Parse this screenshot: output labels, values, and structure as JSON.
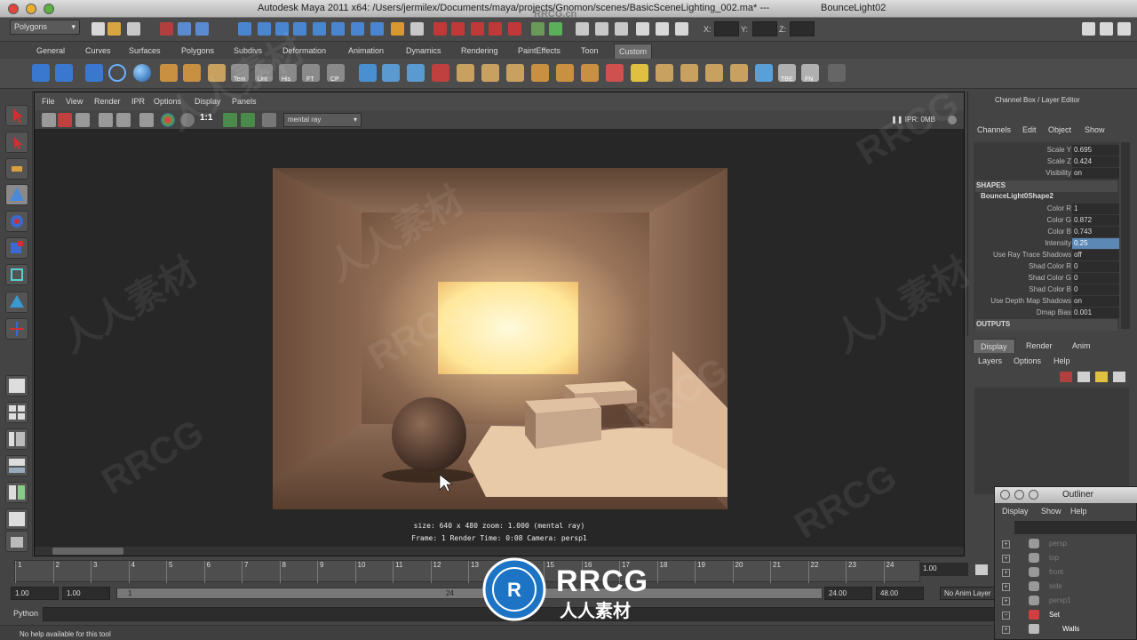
{
  "window": {
    "title": "Autodesk Maya 2011 x64: /Users/jermilex/Documents/maya/projects/Gnomon/scenes/BasicSceneLighting_002.ma*   ---   BounceLight02",
    "title_main": "Autodesk Maya 2011 x64: /Users/jermilex/Documents/maya/projects/Gnomon/scenes/BasicSceneLighting_002.ma*   ---",
    "object": "BounceLight02"
  },
  "status_line": {
    "menuset": "Polygons",
    "x_label": "X:",
    "y_label": "Y:",
    "z_label": "Z:"
  },
  "shelf": {
    "tabs": [
      "General",
      "Curves",
      "Surfaces",
      "Polygons",
      "Subdivs",
      "Deformation",
      "Animation",
      "Dynamics",
      "Rendering",
      "PaintEffects",
      "Toon",
      "Custom"
    ],
    "active_tab": "Custom",
    "labels": {
      "tem": "Tem",
      "unt": "Unt",
      "his": "His",
      "ft": "FT",
      "cp": "CP",
      "tbe": "TBE",
      "fn": "FN"
    }
  },
  "viewport": {
    "menus": [
      "File",
      "View",
      "Render",
      "IPR",
      "Options",
      "Display",
      "Panels"
    ],
    "renderer": "mental ray",
    "ratio": "1:1",
    "ipr": "IPR: 0MB",
    "info_line1": "size: 640 x 480 zoom: 1.000      (mental ray)",
    "info_line2": "Frame: 1      Render Time: 0:08      Camera: persp1"
  },
  "channel_box": {
    "title": "Channel Box / Layer Editor",
    "menus": [
      "Channels",
      "Edit",
      "Object",
      "Show"
    ],
    "rows_top": [
      {
        "label": "Scale Y",
        "value": "0.695"
      },
      {
        "label": "Scale Z",
        "value": "0.424"
      },
      {
        "label": "Visibility",
        "value": "on"
      }
    ],
    "shapes_header": "SHAPES",
    "shape_name": "BounceLight0Shape2",
    "shape_rows": [
      {
        "label": "Color R",
        "value": "1",
        "selected": false
      },
      {
        "label": "Color G",
        "value": "0.872",
        "selected": false
      },
      {
        "label": "Color B",
        "value": "0.743",
        "selected": false
      },
      {
        "label": "Intensity",
        "value": "0.25",
        "selected": true
      },
      {
        "label": "Use Ray Trace Shadows",
        "value": "off",
        "selected": false
      },
      {
        "label": "Shad Color R",
        "value": "0",
        "selected": false
      },
      {
        "label": "Shad Color G",
        "value": "0",
        "selected": false
      },
      {
        "label": "Shad Color B",
        "value": "0",
        "selected": false
      },
      {
        "label": "Use Depth Map Shadows",
        "value": "on",
        "selected": false
      },
      {
        "label": "Dmap Bias",
        "value": "0.001",
        "selected": false
      }
    ],
    "outputs_header": "OUTPUTS"
  },
  "layer_editor": {
    "tabs": [
      "Display",
      "Render",
      "Anim"
    ],
    "active_tab": "Display",
    "menus": [
      "Layers",
      "Options",
      "Help"
    ]
  },
  "time_slider": {
    "ticks": [
      "1",
      "2",
      "3",
      "4",
      "5",
      "6",
      "7",
      "8",
      "9",
      "10",
      "11",
      "12",
      "13",
      "14",
      "15",
      "16",
      "17",
      "18",
      "19",
      "20",
      "21",
      "22",
      "23",
      "24"
    ],
    "current": "1.00"
  },
  "range_slider": {
    "start_time": "1.00",
    "start_range": "1.00",
    "slider_start": "1",
    "slider_end": "24",
    "end_range": "24.00",
    "end_time": "48.00",
    "anim_layer": "No Anim Layer"
  },
  "command_line": {
    "language": "Python"
  },
  "help_line": {
    "text": "No help available for this tool"
  },
  "outliner": {
    "title": "Outliner",
    "menus": [
      "Display",
      "Show",
      "Help"
    ],
    "items": [
      {
        "label": "persp",
        "style": "dim"
      },
      {
        "label": "top",
        "style": "dim"
      },
      {
        "label": "front",
        "style": "dim"
      },
      {
        "label": "side",
        "style": "dim"
      },
      {
        "label": "persp1",
        "style": "dim"
      },
      {
        "label": "Set",
        "style": "white"
      },
      {
        "label": "Walls",
        "style": "white"
      }
    ]
  },
  "watermark": {
    "brand": "RRCG",
    "chinese": "人人素材",
    "site": "RRCG.cn"
  },
  "colors": {
    "maya_bg": "#444444",
    "selection_blue": "#5b88b4",
    "render_warm": "#e8b48c",
    "window_light": "#fff2b0"
  }
}
